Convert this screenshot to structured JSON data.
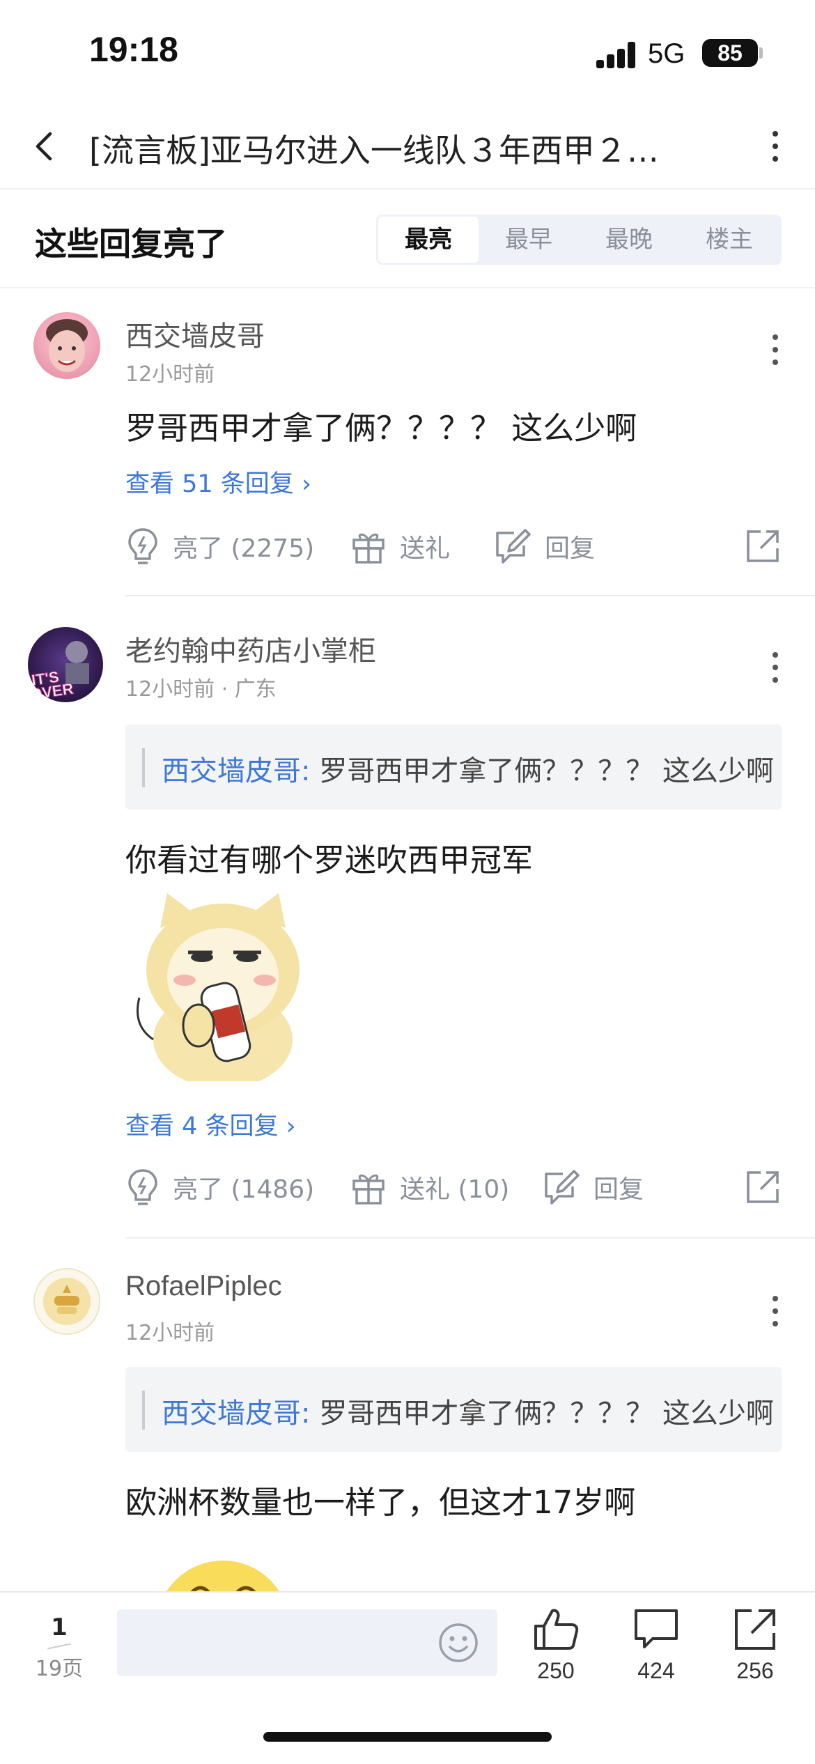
{
  "status": {
    "time": "19:18",
    "network": "5G",
    "battery": "85"
  },
  "nav": {
    "title": "[流言板]亚马尔进入一线队３年西甲２…"
  },
  "section": {
    "title": "这些回复亮了",
    "tabs": [
      "最亮",
      "最早",
      "最晚",
      "楼主"
    ],
    "active_tab": "最亮"
  },
  "comments": [
    {
      "user": "西交墙皮哥",
      "meta": "12小时前",
      "text": "罗哥西甲才拿了俩？？？？ 这么少啊",
      "see_replies": "查看 51 条回复",
      "like": "亮了 (2275)",
      "gift": "送礼",
      "reply": "回复"
    },
    {
      "user": "老约翰中药店小掌柜",
      "meta": "12小时前 · 广东",
      "quote_author": "西交墙皮哥:",
      "quote_text": " 罗哥西甲才拿了俩？？？？ 这么少啊",
      "text": "你看过有哪个罗迷吹西甲冠军",
      "see_replies": "查看 4 条回复",
      "like": "亮了 (1486)",
      "gift": "送礼 (10)",
      "reply": "回复",
      "avatar_text": "IT'S OVER"
    },
    {
      "user": "RofaelPiplec",
      "meta": "12小时前",
      "quote_author": "西交墙皮哥:",
      "quote_text": " 罗哥西甲才拿了俩？？？？ 这么少啊",
      "text": "欧洲杯数量也一样了，但这才17岁啊"
    }
  ],
  "bottom": {
    "page_current": "1",
    "page_total": "19页",
    "like_count": "250",
    "comment_count": "424",
    "share_count": "256"
  },
  "colors": {
    "link": "#3d78d8",
    "muted": "#8a8f99",
    "tabs_bg": "#eef1f8"
  }
}
